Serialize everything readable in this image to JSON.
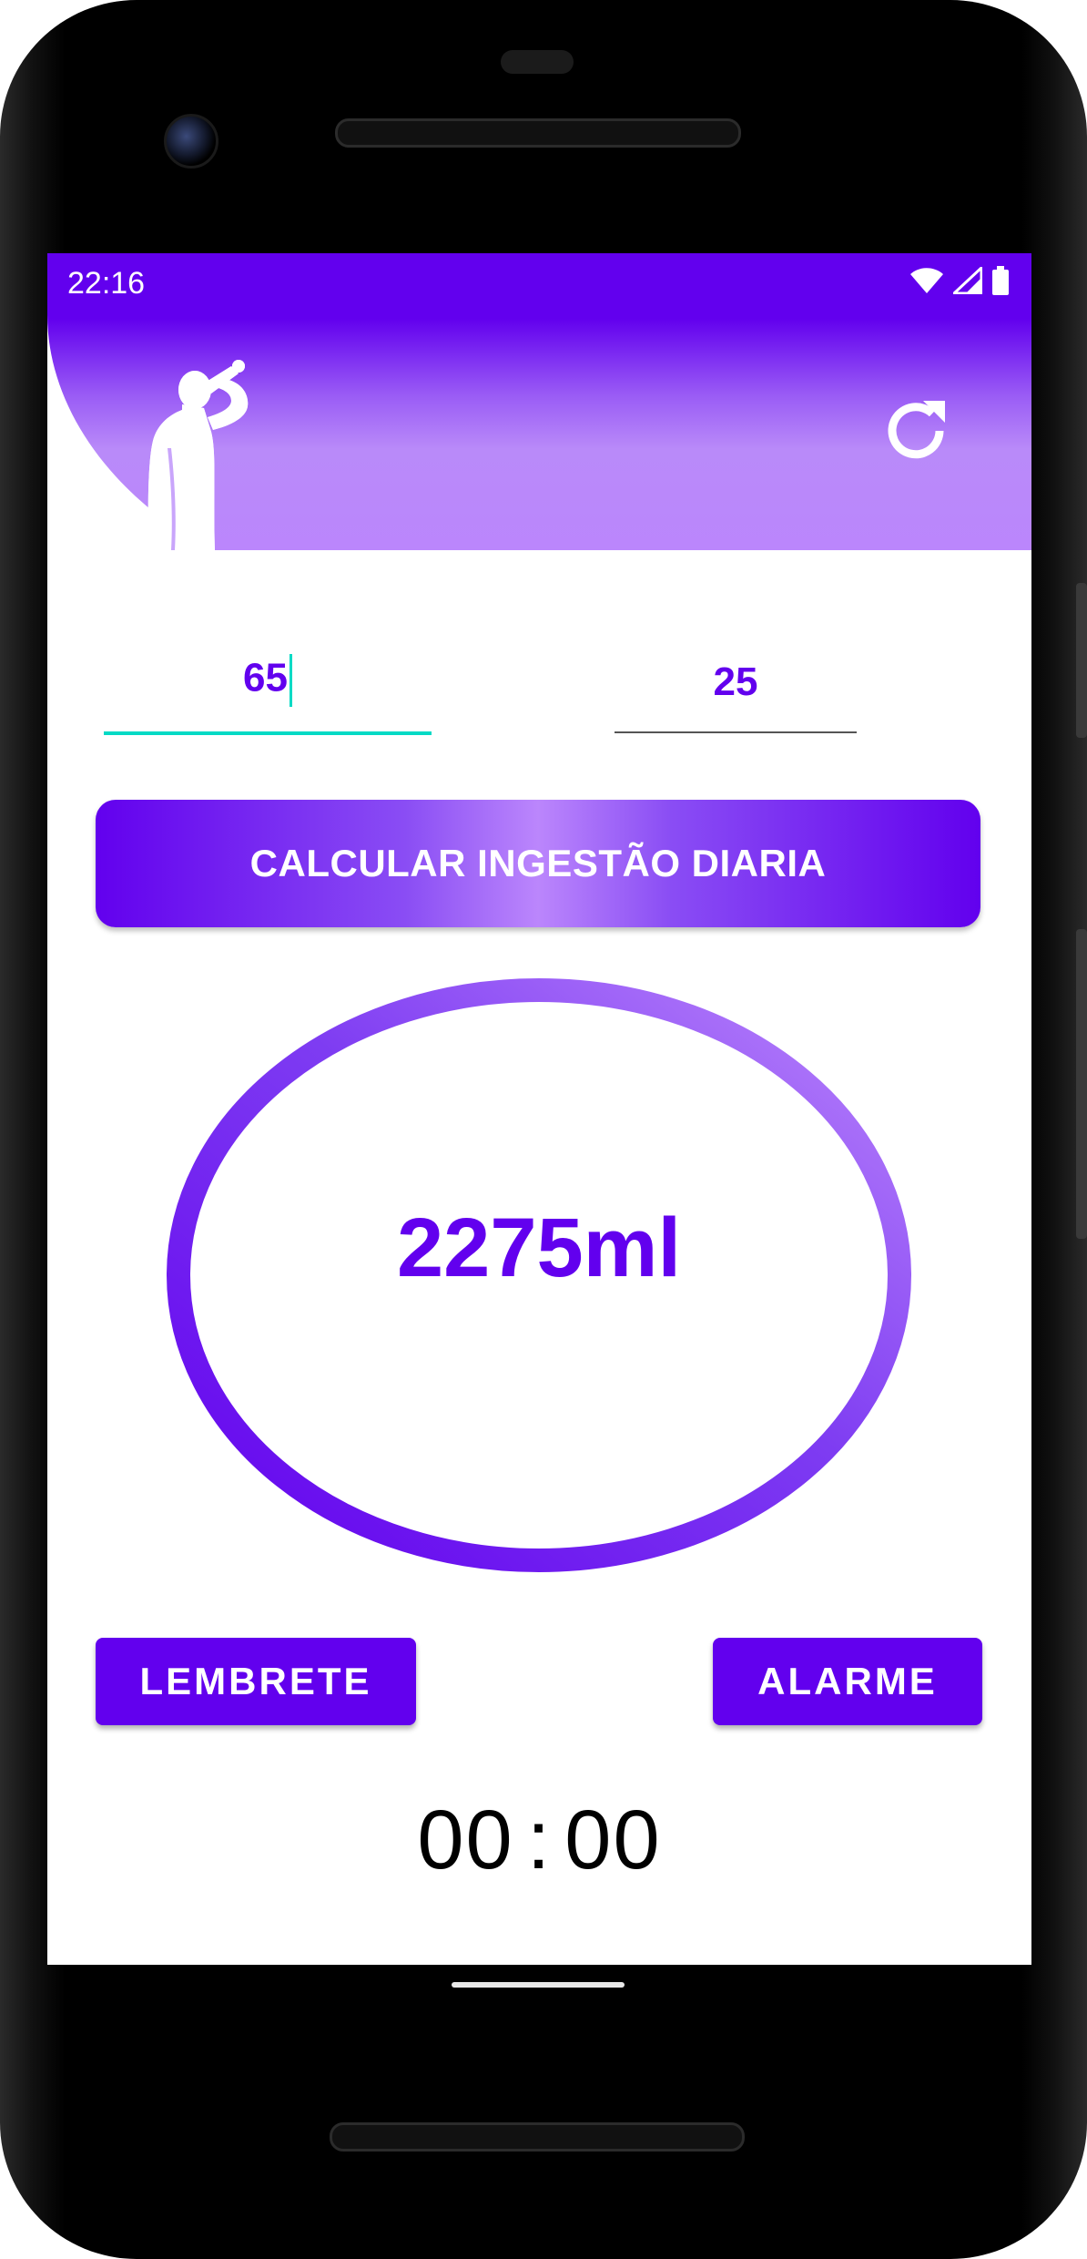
{
  "status_bar": {
    "time": "22:16",
    "icons": [
      "wifi-icon",
      "signal-icon",
      "battery-icon"
    ]
  },
  "header": {
    "illustration": "person-drinking-silhouette",
    "refresh_icon": "refresh-icon"
  },
  "inputs": {
    "weight": {
      "value": "65",
      "focused": true
    },
    "age": {
      "value": "25",
      "focused": false
    }
  },
  "calculate_button": {
    "label": "CALCULAR INGESTÃO DIARIA"
  },
  "result": {
    "value": "2275ml"
  },
  "buttons": {
    "reminder_label": "LEMBRETE",
    "alarm_label": "ALARME"
  },
  "timer": {
    "hours": "00",
    "separator": ":",
    "minutes": "00"
  },
  "colors": {
    "primary": "#6200ee",
    "primary_light": "#bb86fc",
    "accent": "#03dac5"
  }
}
